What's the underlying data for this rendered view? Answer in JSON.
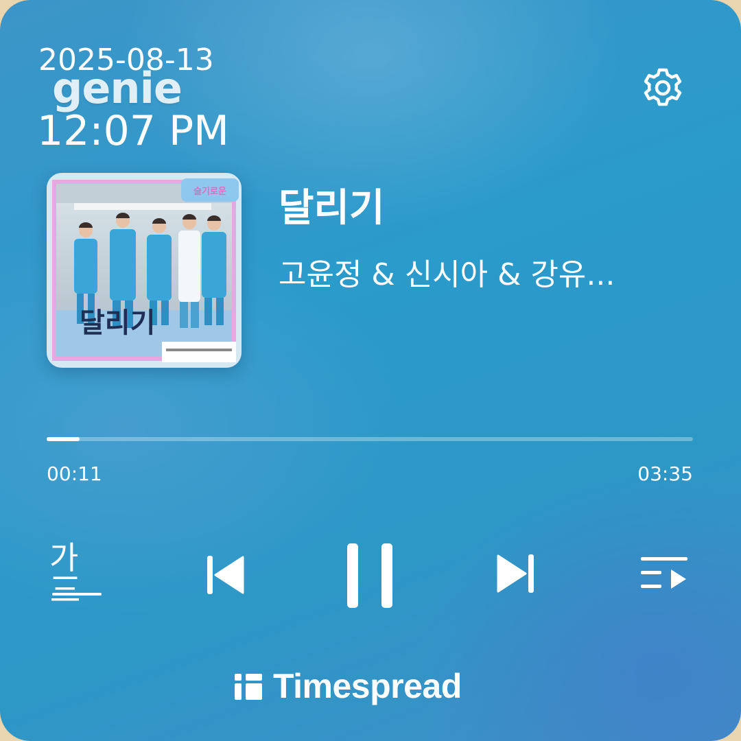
{
  "widget": {
    "app_logo": "genie",
    "date": "2025-08-13",
    "time": "12:07 PM",
    "settings_icon": "gear-icon"
  },
  "track": {
    "album_art_text": "달리기",
    "title": "달리기",
    "artist": "고윤정 & 신시아 & 강유..."
  },
  "progress": {
    "elapsed": "00:11",
    "total": "03:35",
    "fraction": 0.051
  },
  "controls": {
    "lyrics_label": "가三",
    "prev_icon": "skip-previous-icon",
    "pause_icon": "pause-icon",
    "next_icon": "skip-next-icon",
    "playlist_icon": "playlist-icon"
  },
  "brand": {
    "name": "Timespread"
  },
  "colors": {
    "background": "#2d97c6",
    "foreground": "#ffffff",
    "outer": "#e9d6b0"
  }
}
